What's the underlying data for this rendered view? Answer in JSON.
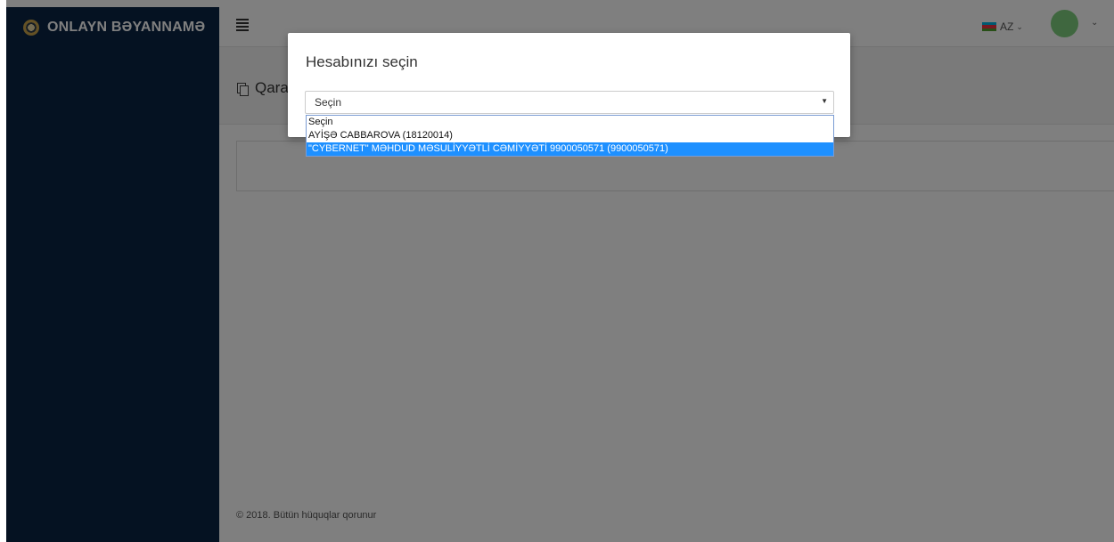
{
  "brand": {
    "title": "ONLAYN BƏYANNAMƏ",
    "logo_icon": "emblem-icon"
  },
  "header": {
    "menu_icon": "hamburger-icon",
    "language": "AZ",
    "flag_colors": [
      "#00b5e2",
      "#ef3340",
      "#509e2f"
    ],
    "avatar_color": "#7fcf7f"
  },
  "page": {
    "title": "Qara",
    "title_icon": "copy-icon"
  },
  "footer": {
    "text": "© 2018. Bütün hüquqlar qorunur"
  },
  "modal": {
    "title": "Hesabınızı seçin",
    "select": {
      "value": "Seçin",
      "options": [
        "Seçin",
        "AYİŞƏ CABBAROVA (18120014)",
        "\"CYBERNET\" MƏHDUD MƏSULİYYƏTLİ CƏMİYYƏTİ 9900050571 (9900050571)"
      ],
      "highlighted_index": 2
    }
  },
  "colors": {
    "sidebar": "#0b2445",
    "highlight": "#1e90ff",
    "overlay": "rgba(0,0,0,0.5)"
  }
}
